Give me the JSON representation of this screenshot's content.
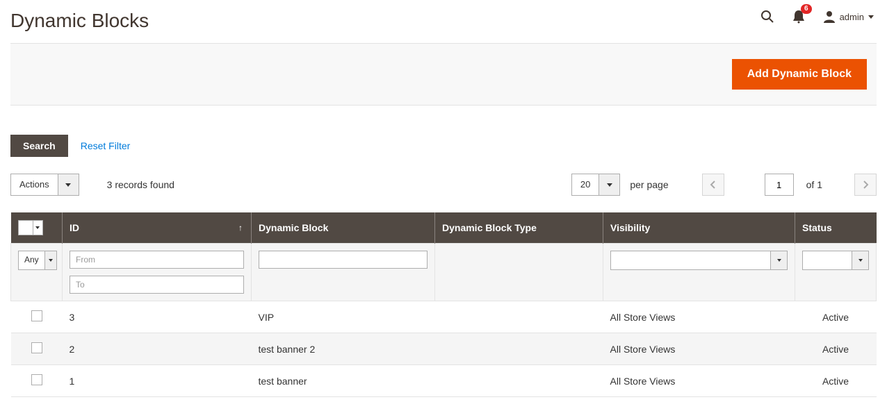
{
  "header": {
    "title": "Dynamic Blocks",
    "notification_count": "6",
    "username": "admin"
  },
  "actionbar": {
    "add_button": "Add Dynamic Block"
  },
  "searchbar": {
    "search_label": "Search",
    "reset_label": "Reset Filter"
  },
  "toolbar": {
    "actions_label": "Actions",
    "records_found": "3 records found",
    "page_size": "20",
    "per_page_label": "per page",
    "current_page": "1",
    "of_label": "of 1"
  },
  "table": {
    "columns": {
      "id": "ID",
      "block": "Dynamic Block",
      "type": "Dynamic Block Type",
      "visibility": "Visibility",
      "status": "Status"
    },
    "filters": {
      "any_label": "Any",
      "from_placeholder": "From",
      "to_placeholder": "To"
    },
    "rows": [
      {
        "id": "3",
        "block": "VIP",
        "type": "",
        "visibility": "All Store Views",
        "status": "Active"
      },
      {
        "id": "2",
        "block": "test banner 2",
        "type": "",
        "visibility": "All Store Views",
        "status": "Active"
      },
      {
        "id": "1",
        "block": "test banner",
        "type": "",
        "visibility": "All Store Views",
        "status": "Active"
      }
    ]
  }
}
